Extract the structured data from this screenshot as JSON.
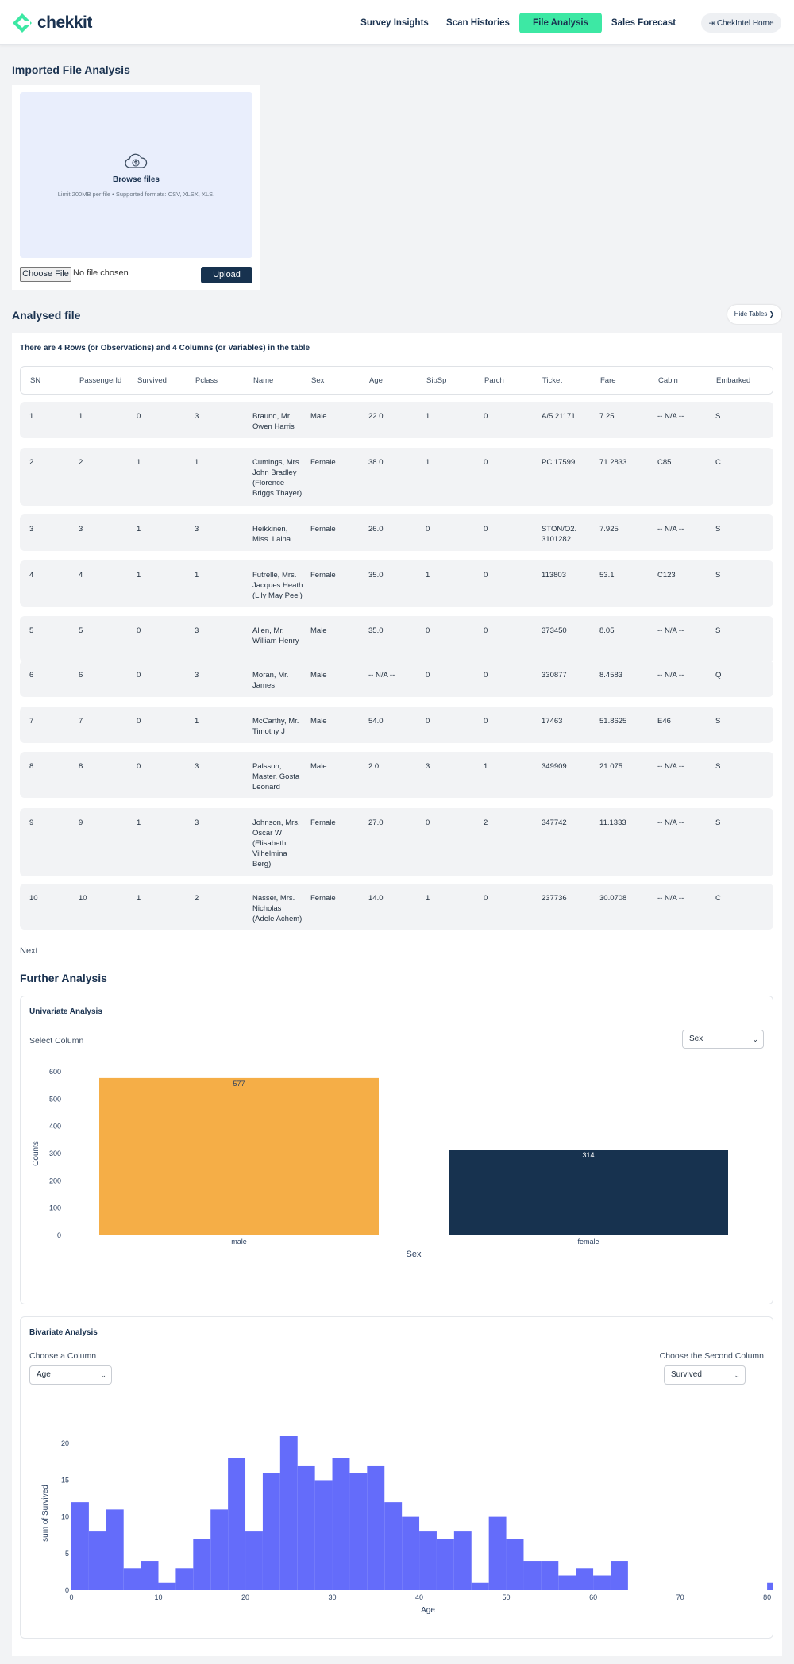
{
  "nav": {
    "brand": "chekkit",
    "items": [
      {
        "label": "Survey Insights",
        "active": false
      },
      {
        "label": "Scan Histories",
        "active": false
      },
      {
        "label": "File Analysis",
        "active": true
      },
      {
        "label": "Sales Forecast",
        "active": false
      }
    ],
    "home_label": "ChekIntel Home"
  },
  "colors": {
    "accent": "#3de8a4",
    "navy": "#17324f",
    "orange": "#f5ae47",
    "purple": "#646cfa"
  },
  "import": {
    "title": "Imported File Analysis",
    "browse_label": "Browse files",
    "limit_text": "Limit 200MB per file • Supported formats: CSV, XLSX, XLS.",
    "choose_file_label": "Choose File",
    "no_file_text": "No file chosen",
    "upload_label": "Upload"
  },
  "analysed": {
    "title": "Analysed file",
    "hide_tables_label": "Hide Tables",
    "summary": "There are 4 Rows (or Observations) and 4 Columns (or Variables) in the table",
    "columns": [
      "SN",
      "PassengerId",
      "Survived",
      "Pclass",
      "Name",
      "Sex",
      "Age",
      "SibSp",
      "Parch",
      "Ticket",
      "Fare",
      "Cabin",
      "Embarked"
    ],
    "rows": [
      [
        "1",
        "1",
        "0",
        "3",
        "Braund, Mr. Owen Harris",
        "Male",
        "22.0",
        "1",
        "0",
        "A/5 21171",
        "7.25",
        "-- N/A --",
        "S"
      ],
      [
        "2",
        "2",
        "1",
        "1",
        "Cumings, Mrs. John Bradley (Florence Briggs Thayer)",
        "Female",
        "38.0",
        "1",
        "0",
        "PC 17599",
        "71.2833",
        "C85",
        "C"
      ],
      [
        "3",
        "3",
        "1",
        "3",
        "Heikkinen, Miss. Laina",
        "Female",
        "26.0",
        "0",
        "0",
        "STON/O2. 3101282",
        "7.925",
        "-- N/A --",
        "S"
      ],
      [
        "4",
        "4",
        "1",
        "1",
        "Futrelle, Mrs. Jacques Heath (Lily May Peel)",
        "Female",
        "35.0",
        "1",
        "0",
        "113803",
        "53.1",
        "C123",
        "S"
      ],
      [
        "5",
        "5",
        "0",
        "3",
        "Allen, Mr. William Henry",
        "Male",
        "35.0",
        "0",
        "0",
        "373450",
        "8.05",
        "-- N/A --",
        "S"
      ],
      [
        "6",
        "6",
        "0",
        "3",
        "Moran, Mr. James",
        "Male",
        "-- N/A --",
        "0",
        "0",
        "330877",
        "8.4583",
        "-- N/A --",
        "Q"
      ],
      [
        "7",
        "7",
        "0",
        "1",
        "McCarthy, Mr. Timothy J",
        "Male",
        "54.0",
        "0",
        "0",
        "17463",
        "51.8625",
        "E46",
        "S"
      ],
      [
        "8",
        "8",
        "0",
        "3",
        "Palsson, Master. Gosta Leonard",
        "Male",
        "2.0",
        "3",
        "1",
        "349909",
        "21.075",
        "-- N/A --",
        "S"
      ],
      [
        "9",
        "9",
        "1",
        "3",
        "Johnson, Mrs. Oscar W (Elisabeth Vilhelmina Berg)",
        "Female",
        "27.0",
        "0",
        "2",
        "347742",
        "11.1333",
        "-- N/A --",
        "S"
      ],
      [
        "10",
        "10",
        "1",
        "2",
        "Nasser, Mrs. Nicholas (Adele Achem)",
        "Female",
        "14.0",
        "1",
        "0",
        "237736",
        "30.0708",
        "-- N/A --",
        "C"
      ]
    ],
    "next_label": "Next"
  },
  "further": {
    "title": "Further Analysis",
    "univariate": {
      "title": "Univariate Analysis",
      "select_label": "Select Column",
      "selected": "Sex"
    },
    "bivariate": {
      "title": "Bivariate Analysis",
      "first_label": "Choose a Column",
      "first_selected": "Age",
      "second_label": "Choose the Second Column",
      "second_selected": "Survived"
    }
  },
  "chart_data": [
    {
      "type": "bar",
      "categories": [
        "male",
        "female"
      ],
      "values": [
        577,
        314
      ],
      "data_labels": [
        "577",
        "314"
      ],
      "colors": [
        "#f5ae47",
        "#17324f"
      ],
      "xlabel": "Sex",
      "ylabel": "Counts",
      "ylim": [
        0,
        600
      ],
      "yticks": [
        0,
        100,
        200,
        300,
        400,
        500,
        600
      ],
      "grid": false
    },
    {
      "type": "bar",
      "subtype": "histogram",
      "bin_width": 2,
      "x_start": 0,
      "values": [
        12,
        8,
        11,
        3,
        4,
        1,
        3,
        7,
        11,
        18,
        8,
        16,
        21,
        17,
        15,
        18,
        16,
        17,
        12,
        10,
        8,
        7,
        8,
        1,
        10,
        7,
        4,
        4,
        2,
        3,
        2,
        4,
        0,
        0,
        0,
        0,
        0,
        0,
        0,
        0,
        1
      ],
      "color": "#646cfa",
      "xlabel": "Age",
      "ylabel": "sum of Survived",
      "xlim": [
        0,
        82
      ],
      "xticks": [
        0,
        10,
        20,
        30,
        40,
        50,
        60,
        70,
        80
      ],
      "ylim": [
        0,
        21
      ],
      "yticks": [
        0,
        5,
        10,
        15,
        20
      ],
      "grid": false
    }
  ]
}
